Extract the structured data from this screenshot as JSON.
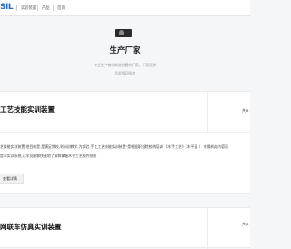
{
  "header": {
    "logo": "SIL",
    "nav": [
      "实验装置",
      "产品",
      "首页"
    ]
  },
  "hero": {
    "title": "生产厂家",
    "line1": "专业生产教学实验装置的厂家，厂家直销",
    "line2": "品质保证服务"
  },
  "cards": [
    {
      "title": "工艺技能实训装置",
      "side": "共 8",
      "desc1": "艺技能实训装置,他目的是,是满足院校,则训训教学,为实验,手工工艺技能实训装置\"是根据职业院校的培训 《木手工艺》（木平面 ） 车操机的内容而",
      "desc2": "是本实训系统,让学员能够快速地了解和掌握木手工艺操作技能",
      "more": "查看详情"
    },
    {
      "title": "网联车仿真实训装置",
      "side": "共 8"
    }
  ],
  "colors": {
    "accent": "#2f6db5",
    "background": "#f5f6f8",
    "card": "#ffffff"
  }
}
